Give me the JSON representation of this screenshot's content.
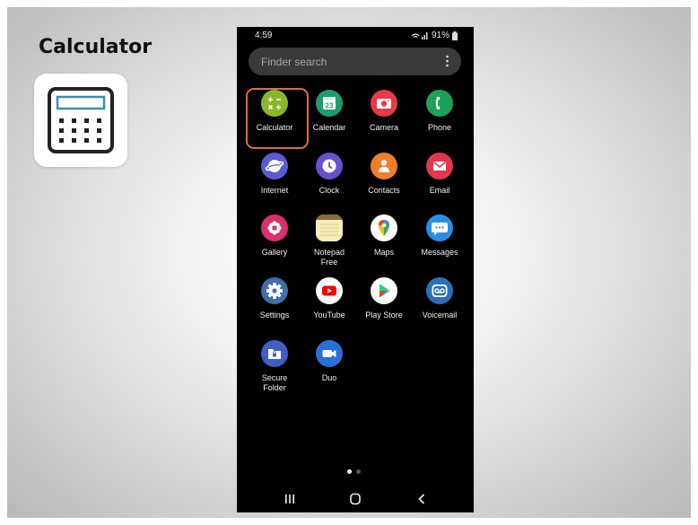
{
  "slide": {
    "title": "Calculator"
  },
  "status": {
    "time": "4:59",
    "battery": "91%"
  },
  "search": {
    "placeholder": "Finder search"
  },
  "page_indicator": {
    "pages": 2,
    "current": 1
  },
  "highlight_color": "#e0702a",
  "apps": [
    {
      "label": "Calculator",
      "icon": "calculator-icon",
      "color": "#8bb62a"
    },
    {
      "label": "Calendar",
      "icon": "calendar-icon",
      "color": "#1f9c6e",
      "badge": "23"
    },
    {
      "label": "Camera",
      "icon": "camera-icon",
      "color": "#e8394a"
    },
    {
      "label": "Phone",
      "icon": "phone-icon",
      "color": "#1fa05a"
    },
    {
      "label": "Internet",
      "icon": "internet-icon",
      "color": "#5b5ad6"
    },
    {
      "label": "Clock",
      "icon": "clock-icon",
      "color": "#6a4fd1"
    },
    {
      "label": "Contacts",
      "icon": "contacts-icon",
      "color": "#f07f27"
    },
    {
      "label": "Email",
      "icon": "email-icon",
      "color": "#e3384a"
    },
    {
      "label": "Gallery",
      "icon": "gallery-icon",
      "color": "#d9306d"
    },
    {
      "label": "Notepad Free",
      "icon": "notepad-icon",
      "color": "#f4eeb6"
    },
    {
      "label": "Maps",
      "icon": "maps-icon",
      "color": "#ffffff"
    },
    {
      "label": "Messages",
      "icon": "messages-icon",
      "color": "#2b8ee6"
    },
    {
      "label": "Settings",
      "icon": "settings-icon",
      "color": "#3f6fa8"
    },
    {
      "label": "YouTube",
      "icon": "youtube-icon",
      "color": "#ffffff"
    },
    {
      "label": "Play Store",
      "icon": "play-store-icon",
      "color": "#ffffff"
    },
    {
      "label": "Voicemail",
      "icon": "voicemail-icon",
      "color": "#2c6fb8"
    },
    {
      "label": "Secure Folder",
      "icon": "secure-folder-icon",
      "color": "#3f5fc4"
    },
    {
      "label": "Duo",
      "icon": "duo-icon",
      "color": "#2a6fd8"
    }
  ]
}
